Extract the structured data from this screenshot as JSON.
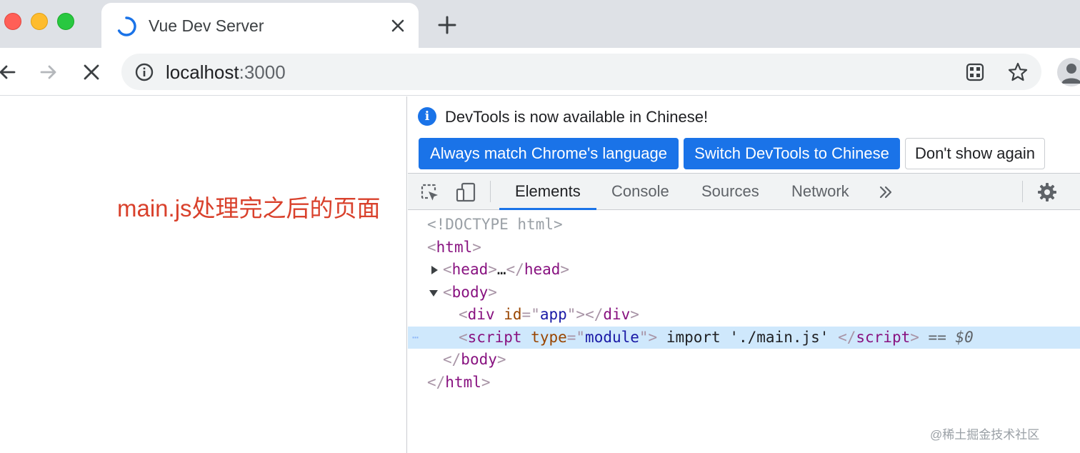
{
  "tab": {
    "title": "Vue Dev Server"
  },
  "address_bar": {
    "host": "localhost",
    "port": ":3000"
  },
  "page": {
    "annotation": "main.js处理完之后的页面"
  },
  "devtools": {
    "infobar": {
      "message": "DevTools is now available in Chinese!",
      "buttons": {
        "match": "Always match Chrome's language",
        "switch": "Switch DevTools to Chinese",
        "dont_show": "Don't show again"
      }
    },
    "tabs": [
      "Elements",
      "Console",
      "Sources",
      "Network"
    ],
    "active_tab": "Elements",
    "dom": {
      "doctype": "<!DOCTYPE html>",
      "html_tag": "html",
      "head_tag": "head",
      "ellipsis": "…",
      "body_tag": "body",
      "div_tag": "div",
      "div_attr_name": "id",
      "div_attr_value": "app",
      "script_tag": "script",
      "script_attr_name": "type",
      "script_attr_value": "module",
      "script_content": " import './main.js' ",
      "selected_marker": "== $0"
    }
  },
  "watermark": "@稀土掘金技术社区",
  "colors": {
    "accent": "#1a73e8",
    "annotation": "#d9412c",
    "selected_row": "#cfe8fc",
    "tag": "#881280",
    "attr_name": "#994500",
    "attr_value": "#1a1aa6"
  },
  "icons": {
    "tab": [
      "loading-spinner-icon",
      "close-icon",
      "plus-icon"
    ],
    "toolbar": [
      "back-arrow-icon",
      "forward-arrow-icon",
      "stop-icon",
      "info-icon",
      "apps-grid-icon",
      "star-icon",
      "profile-icon"
    ],
    "devtools": [
      "info-icon",
      "inspect-element-icon",
      "device-toolbar-icon",
      "more-tabs-icon",
      "gear-icon"
    ]
  }
}
